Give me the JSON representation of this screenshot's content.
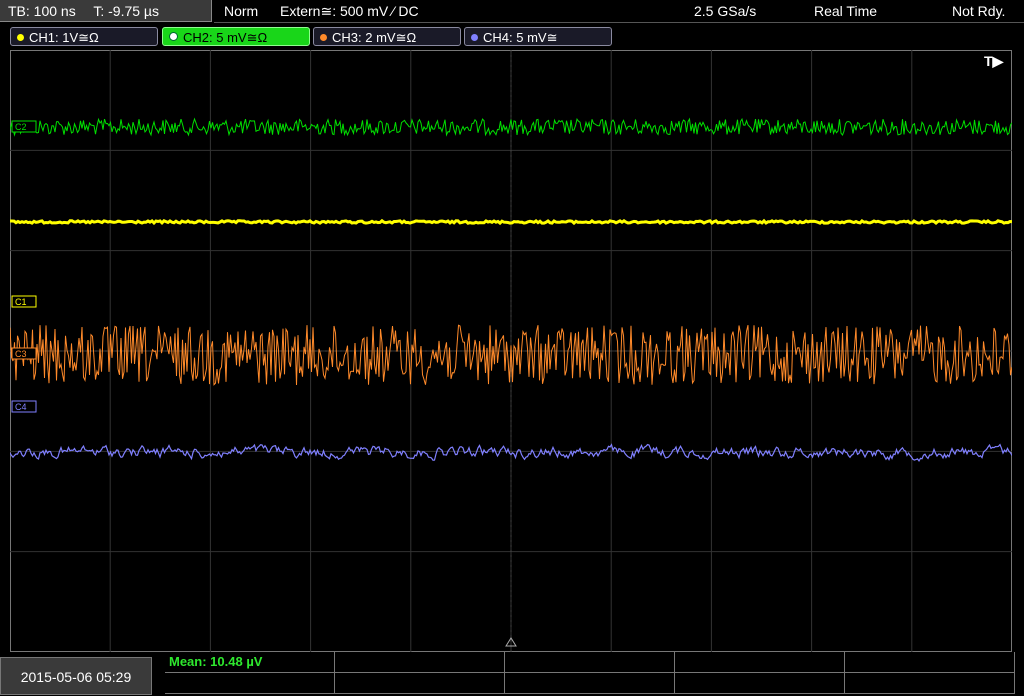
{
  "status": {
    "timebase": "TB: 100 ns",
    "trigger_time": "T: -9.75 µs",
    "mode": "Norm",
    "trigger_source": "Extern≅: 500 mV ⁄ DC",
    "sample_rate": "2.5 GSa/s",
    "acquisition": "Real Time",
    "state": "Not Rdy."
  },
  "channels": [
    {
      "label": "CH1: 1V≅Ω",
      "color": "#ffff00",
      "active": false
    },
    {
      "label": "CH2: 5 mV≅Ω",
      "color": "#00e000",
      "active": true
    },
    {
      "label": "CH3: 2 mV≅Ω",
      "color": "#ff8a2a",
      "active": false
    },
    {
      "label": "CH4: 5 mV≅",
      "color": "#8080ff",
      "active": false
    }
  ],
  "markers": {
    "trigger": "T▶",
    "c2": "C2",
    "c1": "C1",
    "c3": "C3",
    "c4": "C4"
  },
  "bottom": {
    "datetime": "2015-05-06 05:29",
    "measurement": "Mean: 10.48 µV"
  },
  "colors": {
    "ch1": "#ffff00",
    "ch2": "#00e000",
    "ch3": "#ff8a2a",
    "ch4": "#8080ff",
    "grid": "#3a3a3a"
  }
}
